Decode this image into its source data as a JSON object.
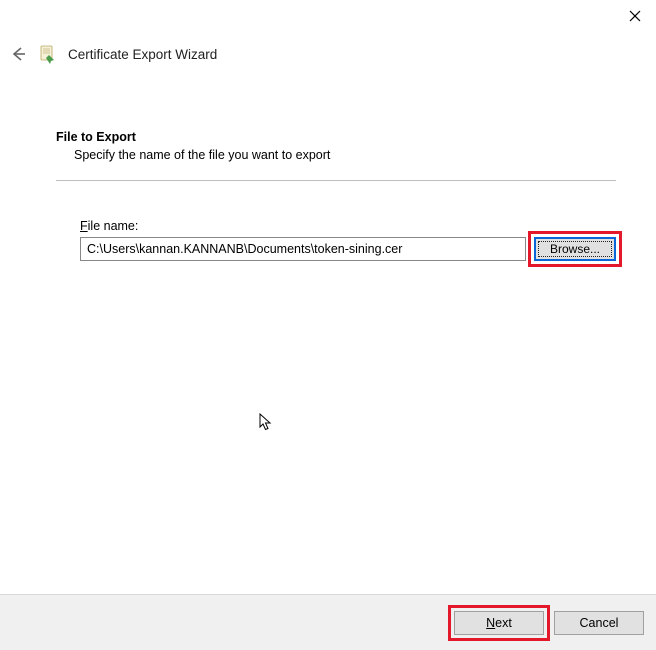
{
  "window": {
    "title": "Certificate Export Wizard"
  },
  "section": {
    "heading": "File to Export",
    "subtext": "Specify the name of the file you want to export"
  },
  "field": {
    "label_prefix": "F",
    "label_rest": "ile name:",
    "value": "C:\\Users\\kannan.KANNANB\\Documents\\token-sining.cer",
    "browse_label": "Browse..."
  },
  "footer": {
    "next_prefix": "N",
    "next_rest": "ext",
    "cancel": "Cancel"
  },
  "colors": {
    "highlight": "#e3192b",
    "focus": "#0a66d8",
    "footer_bg": "#f0f0f0"
  }
}
